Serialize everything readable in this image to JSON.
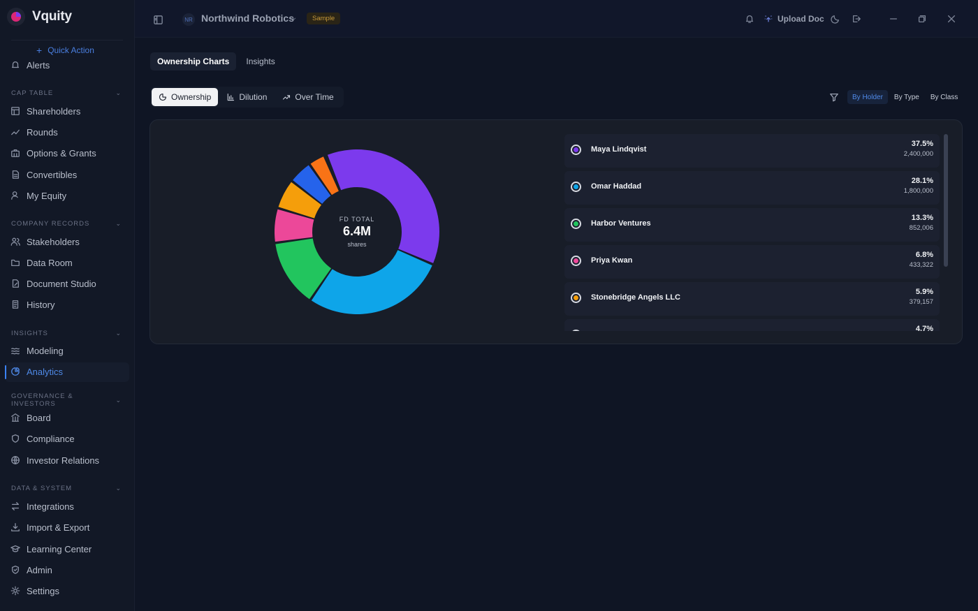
{
  "brand": {
    "name": "Vquity"
  },
  "sidebar": {
    "quick_action": "Quick Action",
    "partial_item": "Alerts",
    "sections": [
      {
        "title": "CAP TABLE",
        "items": [
          "Shareholders",
          "Rounds",
          "Options & Grants",
          "Convertibles",
          "My Equity"
        ]
      },
      {
        "title": "COMPANY RECORDS",
        "items": [
          "Stakeholders",
          "Data Room",
          "Document Studio",
          "History"
        ]
      },
      {
        "title": "INSIGHTS",
        "items": [
          "Modeling",
          "Analytics"
        ]
      },
      {
        "title": "GOVERNANCE & INVESTORS",
        "items": [
          "Board",
          "Compliance",
          "Investor Relations"
        ]
      },
      {
        "title": "DATA & SYSTEM",
        "items": [
          "Integrations",
          "Import & Export",
          "Learning Center",
          "Admin",
          "Settings"
        ]
      }
    ],
    "active_item": "Analytics"
  },
  "topbar": {
    "org_initials": "NR",
    "org_name": "Northwind Robotics",
    "badge": "Sample",
    "upload_label": "Upload Doc"
  },
  "tabs": [
    "Ownership Charts",
    "Insights"
  ],
  "active_tab": "Ownership Charts",
  "views": [
    "Ownership",
    "Dilution",
    "Over Time"
  ],
  "active_view": "Ownership",
  "group_by": [
    "By Holder",
    "By Type",
    "By Class"
  ],
  "active_group": "By Holder",
  "donut": {
    "center_label": "FD TOTAL",
    "center_value": "6.4M",
    "center_unit": "shares"
  },
  "chart_data": {
    "type": "pie",
    "variant": "donut",
    "series": [
      {
        "name": "Maya Lindqvist",
        "percent": 37.5,
        "shares": 2400000,
        "color": "#7c3aed"
      },
      {
        "name": "Omar Haddad",
        "percent": 28.1,
        "shares": 1800000,
        "color": "#0ea5e9"
      },
      {
        "name": "Harbor Ventures",
        "percent": 13.3,
        "shares": 852006,
        "color": "#22c55e"
      },
      {
        "name": "Priya Kwan",
        "percent": 6.8,
        "shares": 433322,
        "color": "#ec4899"
      },
      {
        "name": "Stonebridge Angels LLC",
        "percent": 5.9,
        "shares": 379157,
        "color": "#f59e0b"
      },
      {
        "percent": 4.7,
        "color": "#2563eb"
      },
      {
        "percent": 3.3,
        "color": "#f97316"
      },
      {
        "percent": 0.4,
        "color": "#a855f7"
      }
    ]
  },
  "legend": [
    {
      "name": "Maya Lindqvist",
      "percent": "37.5%",
      "shares": "2,400,000",
      "color": "#7c3aed"
    },
    {
      "name": "Omar Haddad",
      "percent": "28.1%",
      "shares": "1,800,000",
      "color": "#0ea5e9"
    },
    {
      "name": "Harbor Ventures",
      "percent": "13.3%",
      "shares": "852,006",
      "color": "#22c55e"
    },
    {
      "name": "Priya Kwan",
      "percent": "6.8%",
      "shares": "433,322",
      "color": "#ec4899"
    },
    {
      "name": "Stonebridge Angels LLC",
      "percent": "5.9%",
      "shares": "379,157",
      "color": "#f59e0b"
    },
    {
      "name": "",
      "percent": "4.7%",
      "shares": "",
      "color": "#2563eb"
    }
  ]
}
